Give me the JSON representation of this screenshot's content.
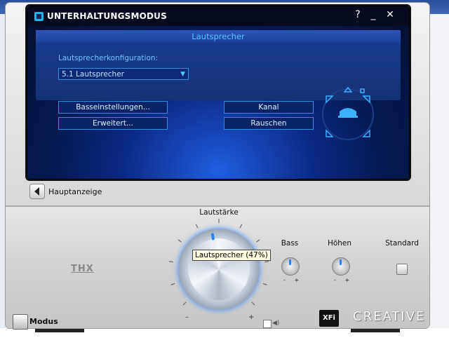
{
  "window": {
    "title": "UNTERHALTUNGSMODUS",
    "help_label": "?",
    "minimize_label": "_",
    "close_label": "✕"
  },
  "panel": {
    "title": "Lautsprecher",
    "config_label": "Lautsprecherkonfiguration:",
    "config_value": "5.1 Lautsprecher",
    "buttons": {
      "bass": "Basseinstellungen...",
      "advanced": "Erweitert...",
      "channel": "Kanal",
      "noise": "Rauschen"
    }
  },
  "nav": {
    "back_label": "Hauptanzeige"
  },
  "controls": {
    "volume_label": "Lautstärke",
    "volume_tooltip": "Lautsprecher (47%)",
    "volume_level": 47,
    "bass_label": "Bass",
    "treble_label": "Höhen",
    "default_label": "Standard",
    "thx_label": "THX",
    "mode_label": "Modus"
  },
  "branding": {
    "xfi": "XFi",
    "creative": "CREATIVE"
  },
  "colors": {
    "accent": "#2a82ff",
    "panel_title": "#55c6ff"
  }
}
